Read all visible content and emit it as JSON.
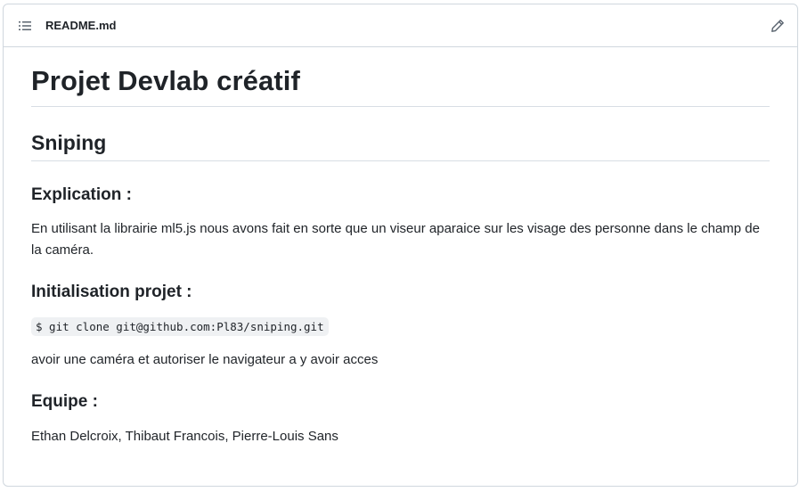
{
  "header": {
    "filename": "README.md",
    "list_icon": "list-unordered-icon",
    "edit_icon": "pencil-icon"
  },
  "readme": {
    "title": "Projet Devlab créatif",
    "subtitle": "Sniping",
    "sections": [
      {
        "heading": "Explication :",
        "text": "En utilisant la librairie ml5.js nous avons fait en sorte que un viseur aparaice sur les visage des personne dans le champ de la caméra."
      },
      {
        "heading": "Initialisation projet :",
        "code": "$ git clone git@github.com:Pl83/sniping.git",
        "text": "avoir une caméra et autoriser le navigateur a y avoir acces"
      },
      {
        "heading": "Equipe :",
        "text": "Ethan Delcroix, Thibaut Francois, Pierre-Louis Sans"
      }
    ]
  },
  "colors": {
    "border": "#d0d7de",
    "text": "#1f2328",
    "icon": "#59636e",
    "code_bg": "#eff1f3"
  }
}
